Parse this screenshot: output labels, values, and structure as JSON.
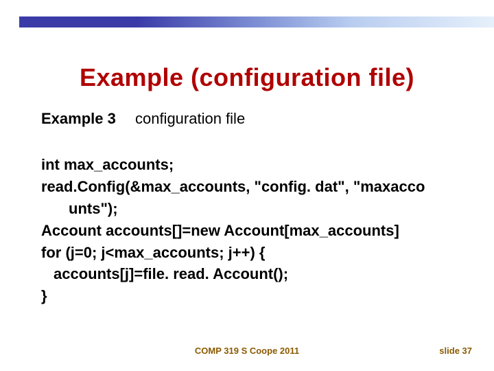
{
  "header": {
    "title": "Example (configuration file)",
    "example_label": "Example 3",
    "example_desc": "configuration file"
  },
  "code": {
    "lines": [
      {
        "text": "int max_accounts;",
        "indent": ""
      },
      {
        "text": "read.Config(&max_accounts, \"config. dat\", \"maxacco",
        "indent": ""
      },
      {
        "text": "unts\");",
        "indent": "indent1"
      },
      {
        "text": "Account accounts[]=new Account[max_accounts]",
        "indent": ""
      },
      {
        "text": "for (j=0; j<max_accounts; j++) {",
        "indent": ""
      },
      {
        "text": "accounts[j]=file. read. Account();",
        "indent": "indent-half"
      },
      {
        "text": "}",
        "indent": ""
      }
    ]
  },
  "footer": {
    "course": "COMP 319 S Coope 2011",
    "slide": "slide 37"
  }
}
